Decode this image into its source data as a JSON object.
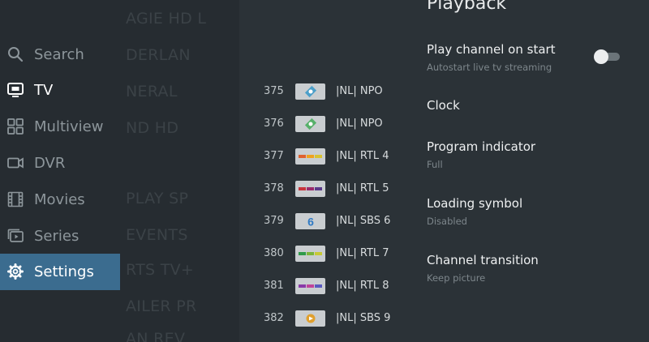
{
  "nav": {
    "items": [
      {
        "label": "Search",
        "icon": "search-icon"
      },
      {
        "label": "TV",
        "icon": "tv-icon"
      },
      {
        "label": "Multiview",
        "icon": "grid-icon"
      },
      {
        "label": "DVR",
        "icon": "camera-icon"
      },
      {
        "label": "Movies",
        "icon": "film-icon"
      },
      {
        "label": "Series",
        "icon": "series-icon"
      },
      {
        "label": "Settings",
        "icon": "gear-icon"
      }
    ],
    "active": "Settings"
  },
  "ghost_groups": [
    "AGIE HD L",
    "DERLAN",
    "NERAL",
    "ND HD",
    "PLAY SP",
    "EVENTS",
    "RTS TV+",
    "AILER PR",
    "AN REV"
  ],
  "channels": [
    {
      "number": "375",
      "name": "|NL| NPO",
      "logo": "npo-logo"
    },
    {
      "number": "376",
      "name": "|NL| NPO",
      "logo": "npo-logo"
    },
    {
      "number": "377",
      "name": "|NL| RTL 4",
      "logo": "rtl-logo"
    },
    {
      "number": "378",
      "name": "|NL| RTL 5",
      "logo": "rtl-logo"
    },
    {
      "number": "379",
      "name": "|NL| SBS 6",
      "logo": "sbs6-logo"
    },
    {
      "number": "380",
      "name": "|NL| RTL 7",
      "logo": "rtl-logo"
    },
    {
      "number": "381",
      "name": "|NL| RTL 8",
      "logo": "rtl-logo"
    },
    {
      "number": "382",
      "name": "|NL| SBS 9",
      "logo": "sbs9-logo"
    }
  ],
  "panel": {
    "title": "Playback",
    "settings": [
      {
        "title": "Play channel on start",
        "subtitle": "Autostart live tv streaming",
        "toggle": false
      },
      {
        "title": "Clock",
        "subtitle": ""
      },
      {
        "title": "Program indicator",
        "subtitle": "Full"
      },
      {
        "title": "Loading symbol",
        "subtitle": "Disabled"
      },
      {
        "title": "Channel transition",
        "subtitle": "Keep picture"
      }
    ]
  },
  "colors": {
    "background": "#2b3237",
    "nav_background": "#262c31",
    "active_highlight": "#3b6c8f",
    "muted_text": "#8d969b"
  }
}
